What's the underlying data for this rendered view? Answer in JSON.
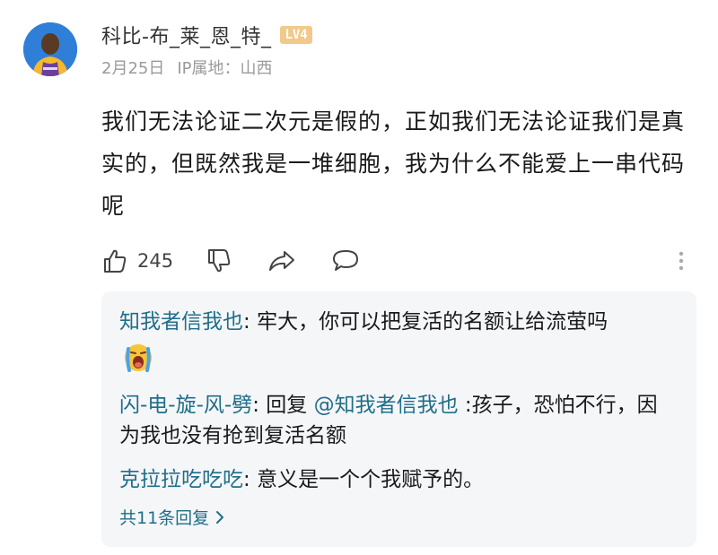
{
  "post": {
    "author": {
      "name": "科比-布_莱_恩_特_",
      "level_badge": "LV4",
      "avatar_icon": "basketball-player-avatar"
    },
    "meta": {
      "date": "2月25日",
      "location": "IP属地：山西"
    },
    "text": "我们无法论证二次元是假的，正如我们无法论证我们是真实的，但既然我是一堆细胞，我为什么不能爱上一串代码呢",
    "actions": {
      "like_count": "245",
      "like_icon": "thumbs-up-icon",
      "dislike_icon": "thumbs-down-icon",
      "share_icon": "share-icon",
      "comment_icon": "comment-icon",
      "more_icon": "more-vertical-icon"
    }
  },
  "replies": {
    "items": [
      {
        "author": "知我者信我也",
        "separator": ": ",
        "text": "牢大，你可以把复活的名额让给流萤吗",
        "emoji": "crying-face-emoji"
      },
      {
        "author": "闪-电-旋-风-劈",
        "separator": ": ",
        "prefix": "回复 ",
        "mention": "@知我者信我也",
        "text": " :孩子，恐怕不行，因为我也没有抢到复活名额"
      },
      {
        "author": "克拉拉吃吃吃",
        "separator": ": ",
        "text": "意义是一个个我赋予的。"
      }
    ],
    "more_label": "共11条回复",
    "more_icon": "chevron-right-icon"
  },
  "colors": {
    "link": "#1f6e8a",
    "muted": "#9a9a9a",
    "panel_bg": "#f5f6f8",
    "badge": "#f2c98b"
  }
}
